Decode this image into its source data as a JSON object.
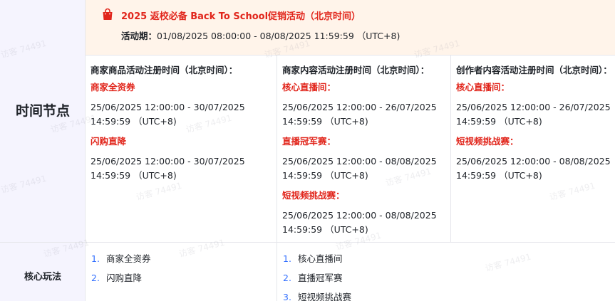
{
  "banner": {
    "title": "2025 返校必备 Back To School促销活动（北京时间）",
    "period_label": "活动期：",
    "period_value": "01/08/2025 08:00:00 - 08/08/2025 11:59:59 （UTC+8)",
    "icon": "shopping-bag-icon",
    "accent_color": "#e1251b",
    "bg_color": "#fff4ea"
  },
  "rows": {
    "timeline_label": "时间节点",
    "core_label": "核心玩法"
  },
  "columns": [
    {
      "header": "商家商品活动注册时间（北京时间）：",
      "items": [
        {
          "name": "商家全资券",
          "line1": "25/06/2025 12:00:00 - 30/07/2025",
          "line2": "14:59:59 （UTC+8)"
        },
        {
          "name": "闪购直降",
          "line1": "25/06/2025 12:00:00 - 30/07/2025",
          "line2": "14:59:59 （UTC+8)"
        }
      ]
    },
    {
      "header": "商家内容活动注册时间（北京时间）：",
      "items": [
        {
          "name": "核心直播间：",
          "line1": "25/06/2025 12:00:00 - 26/07/2025",
          "line2": "14:59:59 （UTC+8)"
        },
        {
          "name": "直播冠军赛：",
          "line1": "25/06/2025 12:00:00 - 08/08/2025",
          "line2": "14:59:59 （UTC+8)"
        },
        {
          "name": "短视频挑战赛：",
          "line1": "25/06/2025 12:00:00 - 08/08/2025",
          "line2": "14:59:59 （UTC+8)"
        }
      ]
    },
    {
      "header": "创作者内容活动注册时间（北京时间）：",
      "items": [
        {
          "name": "核心直播间：",
          "line1": "25/06/2025 12:00:00 - 26/07/2025",
          "line2": "14:59:59 （UTC+8)"
        },
        {
          "name": "短视频挑战赛：",
          "line1": "25/06/2025 12:00:00 - 08/08/2025",
          "line2": "14:59:59 （UTC+8)"
        }
      ]
    }
  ],
  "core": {
    "merchant": [
      {
        "num": "1.",
        "label": "商家全资券"
      },
      {
        "num": "2.",
        "label": "闪购直降"
      }
    ],
    "content": [
      {
        "num": "1.",
        "label": "核心直播间"
      },
      {
        "num": "2.",
        "label": "直播冠军赛"
      },
      {
        "num": "3.",
        "label": "短视频挑战赛"
      }
    ]
  },
  "watermark": {
    "text": "访客 74491"
  }
}
